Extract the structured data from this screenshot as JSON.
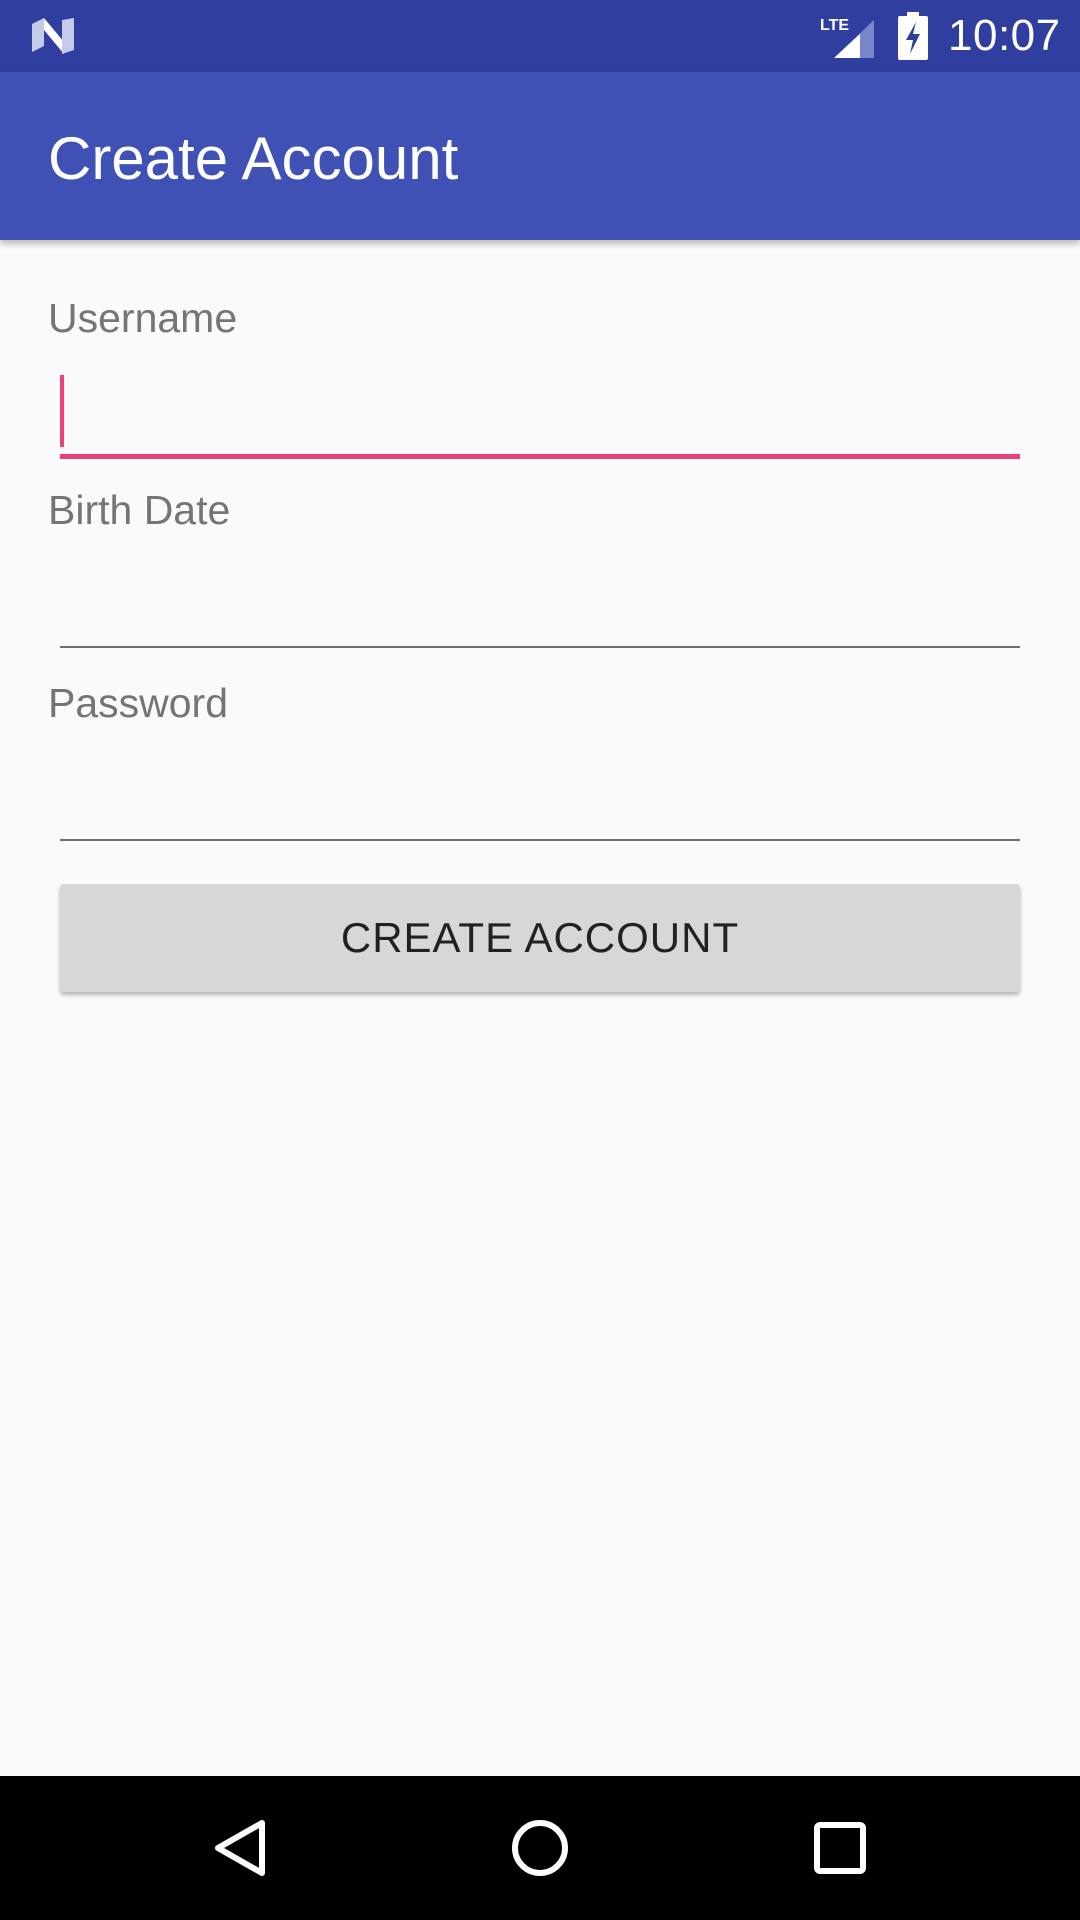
{
  "status_bar": {
    "time": "10:07",
    "network": "LTE",
    "background_color": "#303f9f"
  },
  "app_bar": {
    "title": "Create Account",
    "background_color": "#3f51b5"
  },
  "form": {
    "username": {
      "label": "Username",
      "value": "",
      "focused": true
    },
    "birth_date": {
      "label": "Birth Date",
      "value": ""
    },
    "password": {
      "label": "Password",
      "value": ""
    },
    "submit_label": "CREATE ACCOUNT",
    "accent_color": "#ec407a"
  },
  "nav_bar": {
    "icons": [
      "back-icon",
      "home-icon",
      "recents-icon"
    ]
  }
}
